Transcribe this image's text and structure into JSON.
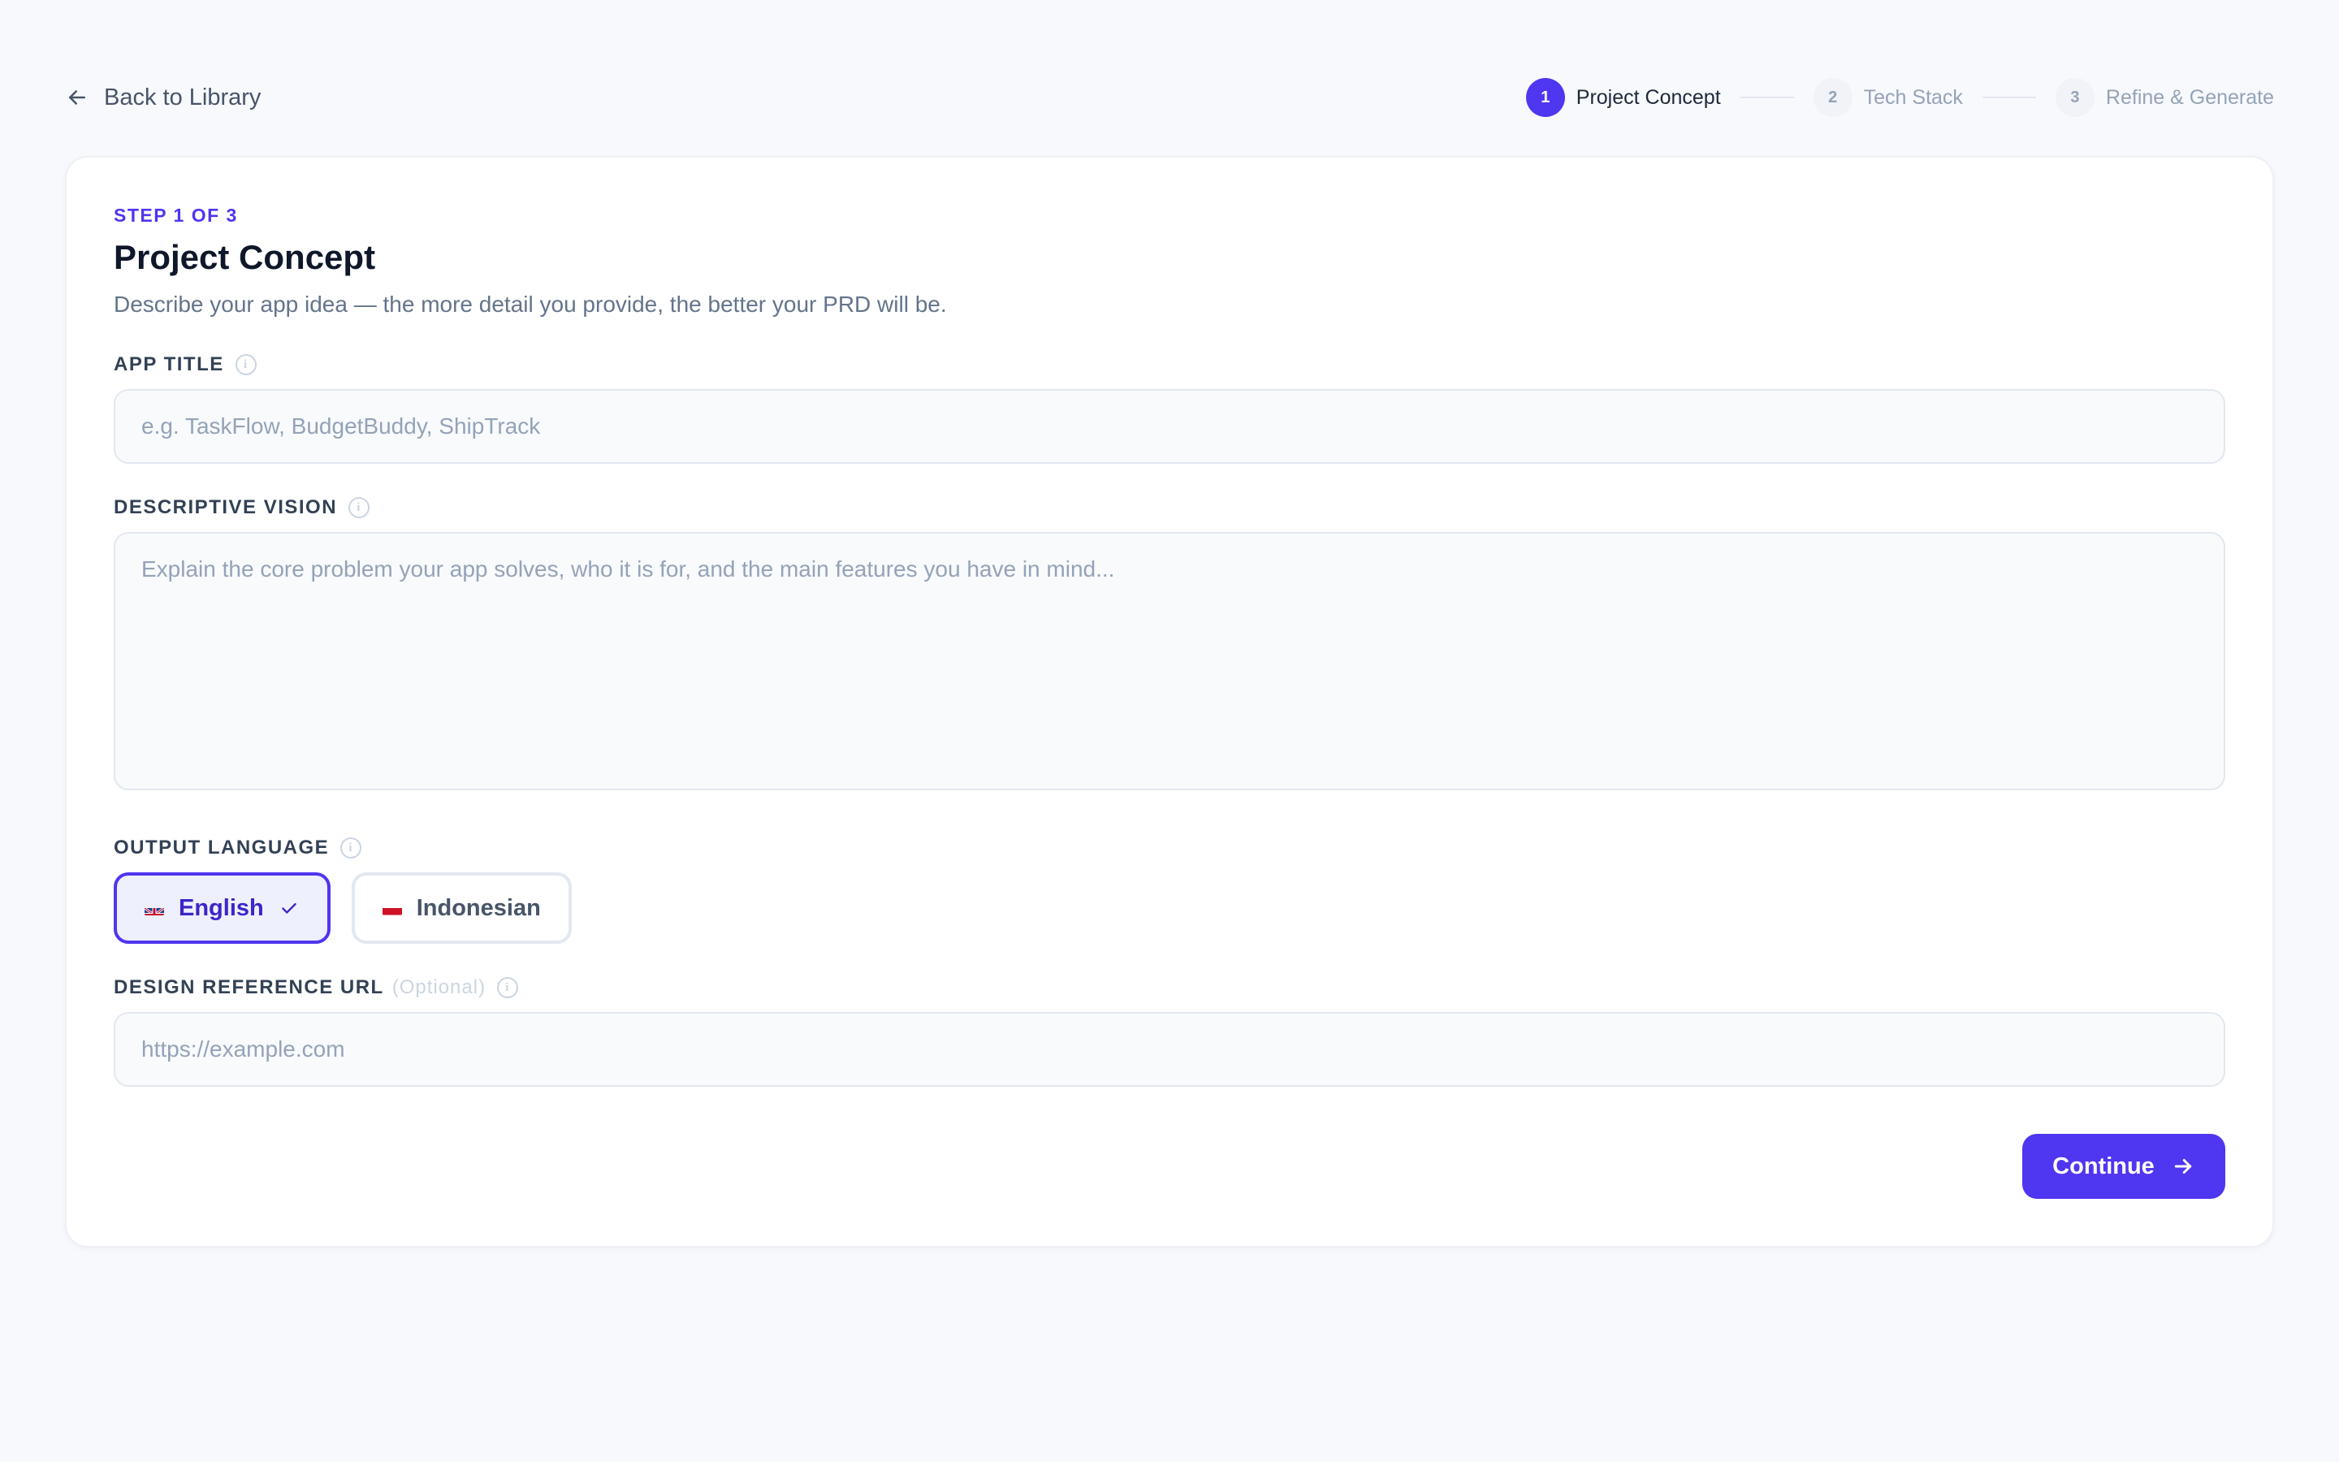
{
  "nav": {
    "back_label": "Back to Library",
    "steps": [
      {
        "number": "1",
        "label": "Project Concept",
        "state": "active"
      },
      {
        "number": "2",
        "label": "Tech Stack",
        "state": "pending"
      },
      {
        "number": "3",
        "label": "Refine & Generate",
        "state": "pending"
      }
    ]
  },
  "form": {
    "step_kicker": "STEP 1 OF 3",
    "title": "Project Concept",
    "subtitle": "Describe your app idea — the more detail you provide, the better your PRD will be.",
    "app_title": {
      "label": "APP TITLE",
      "value": "",
      "placeholder": "e.g. TaskFlow, BudgetBuddy, ShipTrack"
    },
    "vision": {
      "label": "DESCRIPTIVE VISION",
      "value": "",
      "placeholder": "Explain the core problem your app solves, who it is for, and the main features you have in mind..."
    },
    "output_language": {
      "label": "OUTPUT LANGUAGE",
      "options": [
        {
          "label": "English",
          "flag": "uk-flag-icon",
          "selected": true
        },
        {
          "label": "Indonesian",
          "flag": "indonesia-flag-icon",
          "selected": false
        }
      ]
    },
    "design_url": {
      "label": "DESIGN REFERENCE URL",
      "optional_label": "(Optional)",
      "value": "",
      "placeholder": "https://example.com"
    },
    "continue_label": "Continue"
  },
  "colors": {
    "accent": "#4f36f0",
    "background": "#f8f9fd",
    "card": "#ffffff"
  }
}
